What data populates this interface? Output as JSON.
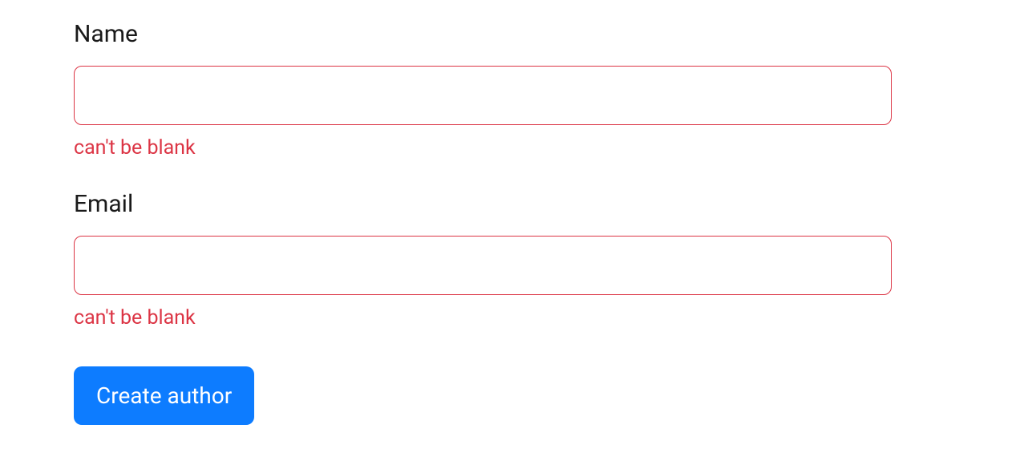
{
  "form": {
    "fields": {
      "name": {
        "label": "Name",
        "value": "",
        "error": "can't be blank"
      },
      "email": {
        "label": "Email",
        "value": "",
        "error": "can't be blank"
      }
    },
    "submit_label": "Create author"
  }
}
